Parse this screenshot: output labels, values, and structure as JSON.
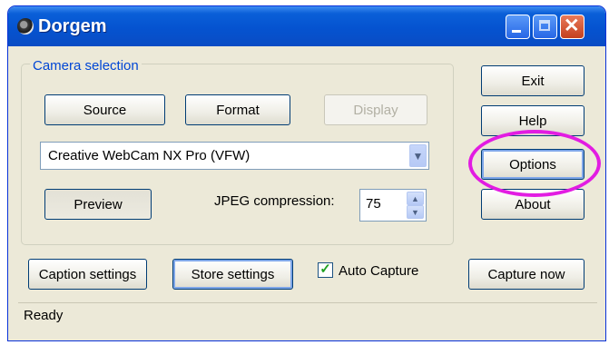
{
  "window": {
    "title": "Dorgem",
    "app_icon": "webcam-icon",
    "titlebar_controls": [
      {
        "name": "minimize-icon"
      },
      {
        "name": "maximize-icon"
      },
      {
        "name": "close-icon",
        "glyph": "✕"
      }
    ]
  },
  "camera_selection": {
    "group_label": "Camera selection",
    "source_label": "Source",
    "format_label": "Format",
    "display_label": "Display",
    "display_enabled": false,
    "camera": "Creative WebCam NX Pro (VFW)",
    "preview_label": "Preview",
    "jpeg_label": "JPEG compression:",
    "jpeg_value": "75"
  },
  "side_buttons": {
    "exit_label": "Exit",
    "help_label": "Help",
    "options_label": "Options",
    "about_label": "About"
  },
  "bottom": {
    "caption_settings_label": "Caption settings",
    "store_settings_label": "Store settings",
    "auto_capture_label": "Auto Capture",
    "auto_capture_checked": true,
    "capture_now_label": "Capture now"
  },
  "status": {
    "text": "Ready"
  },
  "annotation": {
    "highlight_color": "#e21ce2",
    "highlight_target": "Options"
  }
}
